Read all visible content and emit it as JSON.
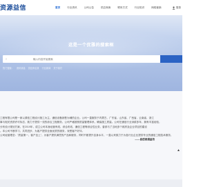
{
  "logo": "资源益信",
  "nav": [
    {
      "label": "首页",
      "active": true
    },
    {
      "label": "行业资讯"
    },
    {
      "label": "公司公告"
    },
    {
      "label": "供应商库"
    },
    {
      "label": "联系方式"
    },
    {
      "label": "行业知识"
    },
    {
      "label": "网络营销"
    }
  ],
  "login": "登录",
  "hero": {
    "title": "这是一个优雅的搜索框",
    "search_placeholder": "输入内容开始搜索"
  },
  "hot_searches": [
    "热门搜索：",
    "资讯消息",
    "供应商名录",
    "行业新闻",
    "关于我们"
  ],
  "content": {
    "lines": [
      "工程有限公司是一家以源信工程设计施工为主，通信设备销售为辅的企业。公司一直服务于内蒙古、广东省、山东省、广西省、云南省、浙江",
      "事与相关资质许可标志，致力于提供一流的综合工程服务，公司严格按照质量管理体系，确保施工质量。公司在通信行业深耕多年，拥有丰富经验，",
      "分布设计规划方案，在2019年，成立公司本身经营有线、综合布线、通信工程等综合性业务，曾参与了当地多个政府及企业项目的建设",
      "。本公司不断学习，共同进步，为客户提供全面优质的服务，深受客户好评。",
      "公司经营理念：\"质量第一，客户至上\"，为客户提供满意的产品和服务，同时不断提升自身水平，一直以来致力于为各行业企业提供专业的通信工程技术服务，"
    ],
    "signature": "——自述者通益坊"
  },
  "scroll_arrow": "▲"
}
